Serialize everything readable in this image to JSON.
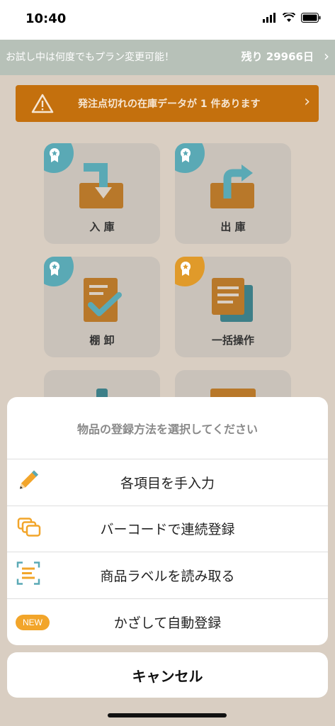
{
  "status_bar": {
    "time": "10:40"
  },
  "trial_banner": {
    "text": "お試し中は何度でもプラン変更可能！",
    "days_left": "残り 29966日"
  },
  "alert": {
    "text": "発注点切れの在庫データが 1 件あります"
  },
  "tiles": [
    {
      "label": "入 庫",
      "badge_color": "#5aa9b5"
    },
    {
      "label": "出 庫",
      "badge_color": "#5aa9b5"
    },
    {
      "label": "棚 卸",
      "badge_color": "#5aa9b5"
    },
    {
      "label": "一括操作",
      "badge_color": "#e09a2a"
    }
  ],
  "action_sheet": {
    "title": "物品の登録方法を選択してください",
    "items": [
      {
        "label": "各項目を手入力",
        "icon": "pencil-icon"
      },
      {
        "label": "バーコードで連続登録",
        "icon": "barcode-stack-icon"
      },
      {
        "label": "商品ラベルを読み取る",
        "icon": "label-scan-icon"
      },
      {
        "label": "かざして自動登録",
        "icon": "new-badge",
        "badge": "NEW"
      }
    ],
    "cancel_label": "キャンセル"
  },
  "colors": {
    "accent_orange": "#e09a2a",
    "accent_teal": "#5aa9b5",
    "alert_orange": "#c4700d"
  }
}
